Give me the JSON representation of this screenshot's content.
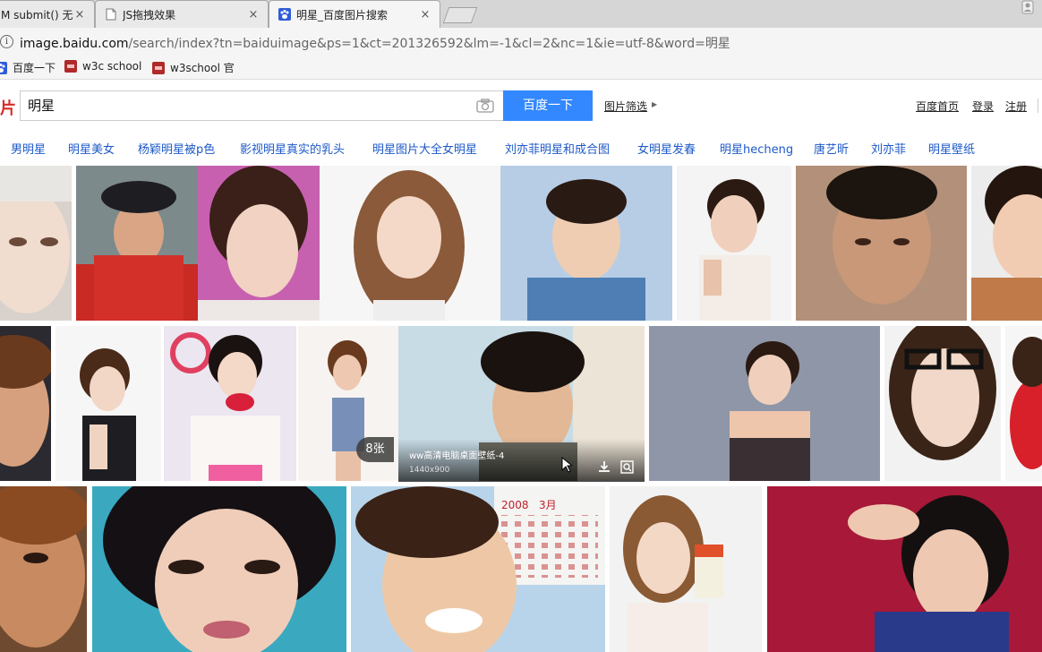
{
  "tabs": [
    {
      "title": "M submit() 无",
      "close": "×"
    },
    {
      "title": "JS拖拽效果",
      "close": "×"
    },
    {
      "title": "明星_百度图片搜索",
      "close": "×"
    }
  ],
  "address": {
    "host": "image.baidu.com",
    "path": "/search/index?tn=baiduimage&ps=1&ct=201326592&lm=-1&cl=2&nc=1&ie=utf-8&word=明星"
  },
  "bookmarks": [
    {
      "label": "百度一下"
    },
    {
      "label": "w3c school"
    },
    {
      "label": "w3school 官"
    }
  ],
  "search": {
    "logo_fragment": "片",
    "query": "明星",
    "button_label": "百度一下",
    "filter_label": "图片筛选"
  },
  "top_links": [
    "百度首页",
    "登录",
    "注册"
  ],
  "related": [
    "男明星",
    "明星美女",
    "杨颖明星被p色",
    "影视明星真实的乳头",
    "明星图片大全女明星",
    "刘亦菲明星和成合图",
    "女明星发春",
    "明星hecheng",
    "唐艺昕",
    "刘亦菲",
    "明星壁纸"
  ],
  "hover": {
    "caption": "ww高清电脑桌面壁纸-4",
    "dimensions": "1440x900"
  },
  "count_badge": "8张",
  "calendar_text": {
    "year": "2008",
    "month": "3月"
  }
}
